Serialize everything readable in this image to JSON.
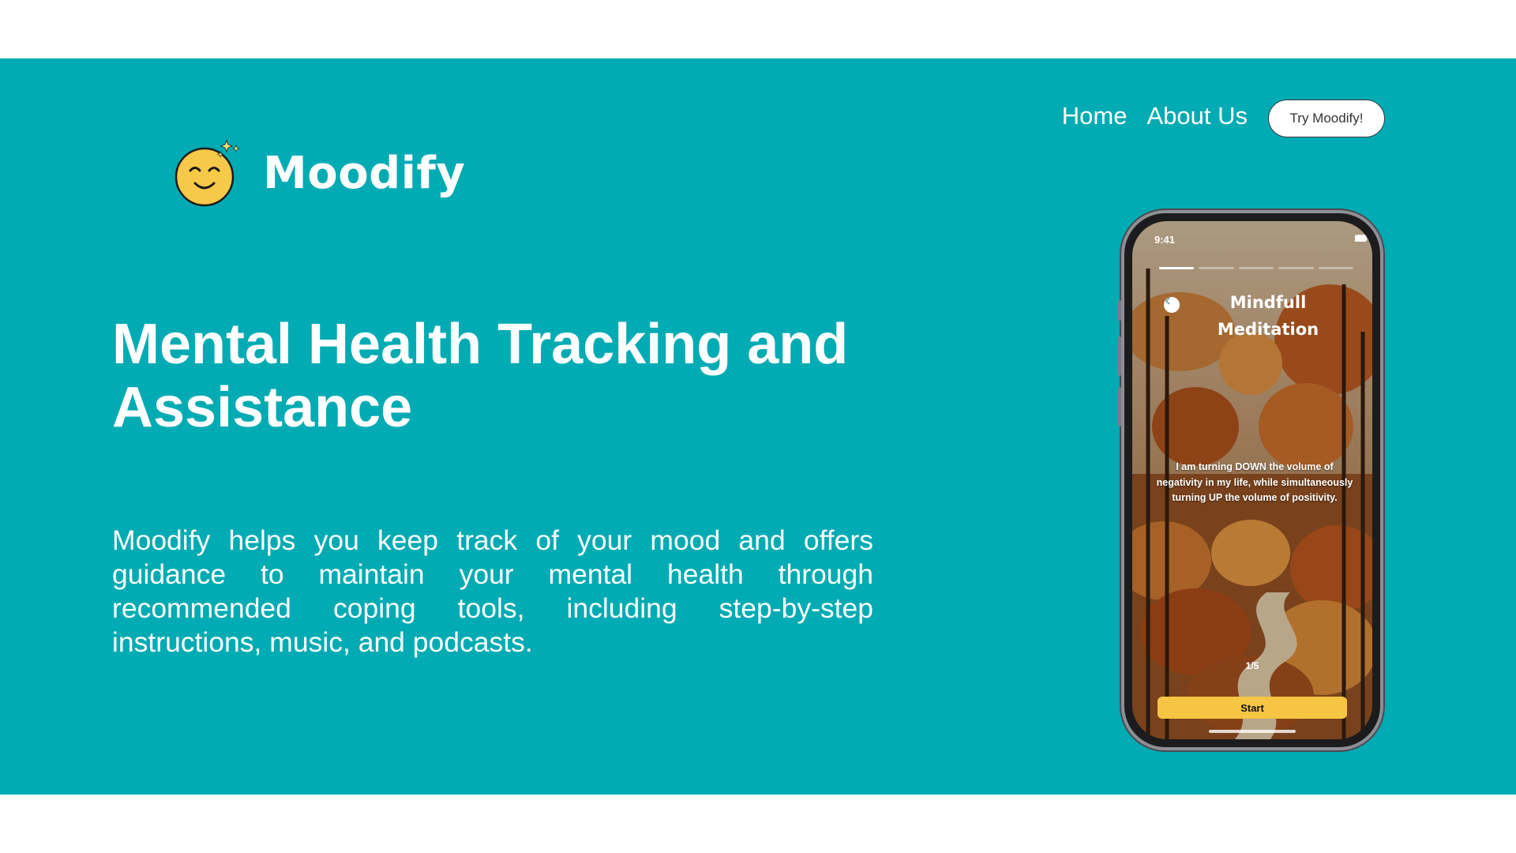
{
  "brand": {
    "name": "Moodify",
    "logo_icon": "smiley-face-icon"
  },
  "nav": {
    "home_label": "Home",
    "about_label": "About Us",
    "cta_label": "Try Moodify!"
  },
  "hero": {
    "headline": "Mental Health Tracking and Assistance",
    "description": "Moodify helps you keep track of your mood and offers guidance to maintain your mental health through recommended coping tools, including step-by-step instructions, music, and podcasts."
  },
  "phone_mockup": {
    "status_time": "9:41",
    "screen_title": "Mindfull Meditation",
    "affirmation": "I am turning DOWN the volume of negativity in my life, while simultaneously turning UP the volume of positivity.",
    "step_counter": "1/5",
    "start_label": "Start"
  },
  "colors": {
    "hero_background": "#00abb3",
    "accent_yellow": "#f5c543",
    "text": "#ffffff"
  }
}
